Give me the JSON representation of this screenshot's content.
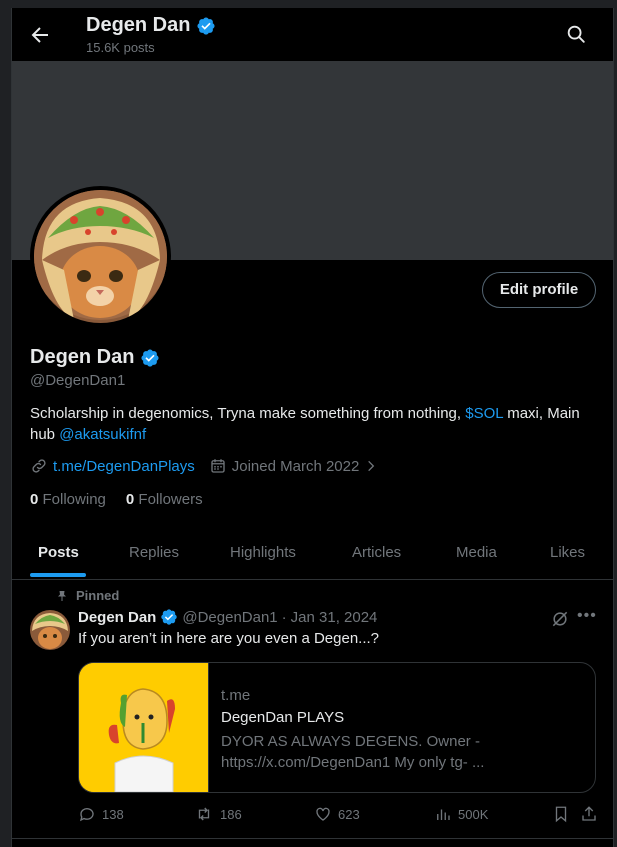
{
  "header": {
    "title": "Degen Dan",
    "posts_count": "15.6K posts"
  },
  "profile": {
    "edit_label": "Edit profile",
    "name": "Degen Dan",
    "handle": "@DegenDan1",
    "bio_text": "Scholarship in degenomics, Tryna make something from nothing, ",
    "bio_tag": "$SOL",
    "bio_mid": " maxi, Main hub ",
    "bio_mention": "@akatsukifnf",
    "link": "t.me/DegenDanPlays",
    "joined": "Joined March 2022",
    "following_count": "0",
    "following_label": "Following",
    "followers_count": "0",
    "followers_label": "Followers",
    "verified_color": "#1d9bf0"
  },
  "tabs": [
    {
      "label": "Posts",
      "active": true
    },
    {
      "label": "Replies"
    },
    {
      "label": "Highlights"
    },
    {
      "label": "Articles"
    },
    {
      "label": "Media"
    },
    {
      "label": "Likes"
    }
  ],
  "pinned_post": {
    "pinned_label": "Pinned",
    "author": "Degen Dan",
    "handle": "@DegenDan1",
    "sep": "·",
    "date": "Jan 31, 2024",
    "text": "If you aren’t in here are you even a Degen...?",
    "card": {
      "domain": "t.me",
      "title": "DegenDan PLAYS",
      "description": "DYOR AS ALWAYS DEGENS. Owner - https://x.com/DegenDan1 My only tg- ..."
    },
    "actions": {
      "replies": "138",
      "reposts": "186",
      "likes": "623",
      "views": "500K"
    }
  },
  "colors": {
    "background": "#000000",
    "accent": "#1d9bf0",
    "muted": "#71767b",
    "banner": "#333639"
  }
}
